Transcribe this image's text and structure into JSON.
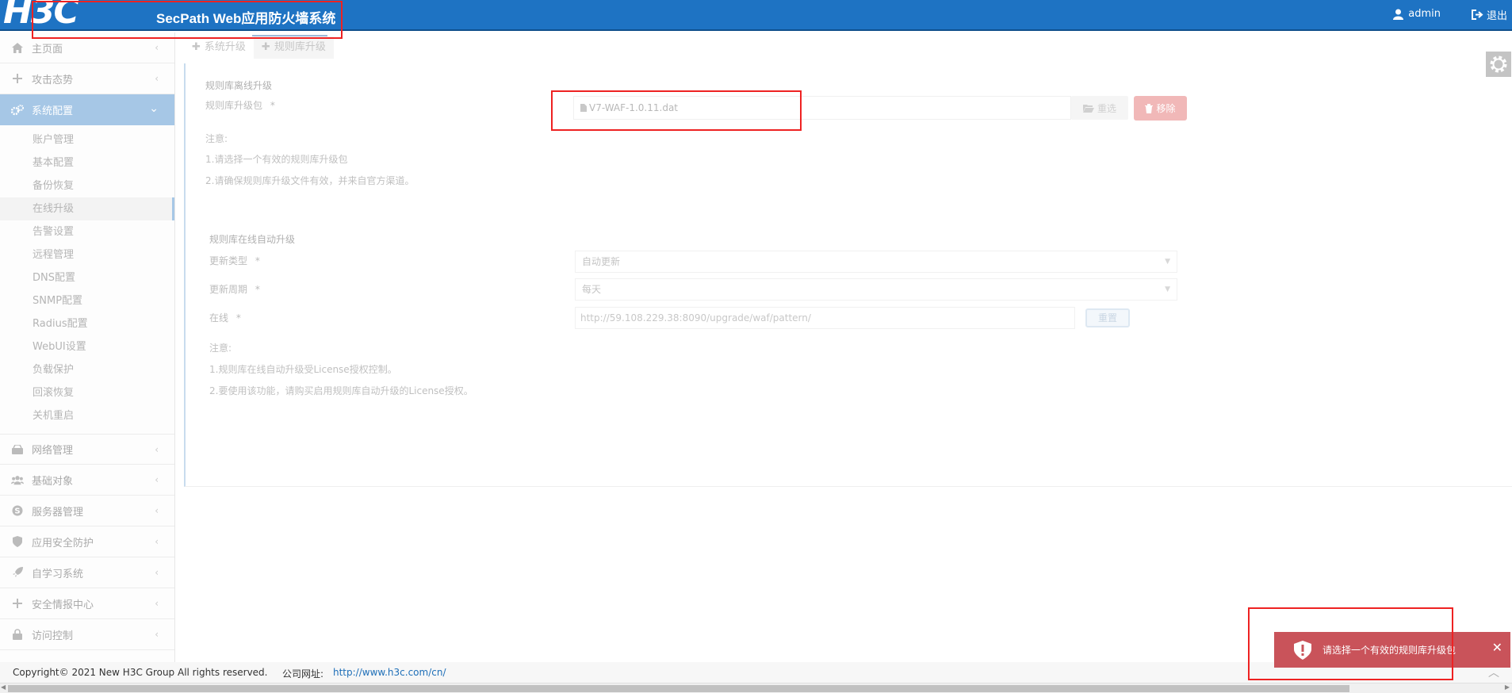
{
  "header": {
    "logo_text": "H3C",
    "app_title": "SecPath Web应用防火墙系统",
    "user": "admin",
    "logout": "退出",
    "bg_color": "#1e73c3"
  },
  "sidebar": {
    "items": [
      {
        "label": "主页面",
        "icon": "home-icon"
      },
      {
        "label": "攻击态势",
        "icon": "plus-icon"
      },
      {
        "label": "系统配置",
        "icon": "gears-icon",
        "active": true
      },
      {
        "label": "网络管理",
        "icon": "hdd-icon"
      },
      {
        "label": "基础对象",
        "icon": "users-icon"
      },
      {
        "label": "服务器管理",
        "icon": "skype-icon"
      },
      {
        "label": "应用安全防护",
        "icon": "shield-icon"
      },
      {
        "label": "自学习系统",
        "icon": "rocket-icon"
      },
      {
        "label": "安全情报中心",
        "icon": "plus-icon"
      },
      {
        "label": "访问控制",
        "icon": "lock-icon"
      }
    ],
    "sub_items": [
      "账户管理",
      "基本配置",
      "备份恢复",
      "在线升级",
      "告警设置",
      "远程管理",
      "DNS配置",
      "SNMP配置",
      "Radius配置",
      "WebUI设置",
      "负载保护",
      "回滚恢复",
      "关机重启"
    ],
    "current_sub": "在线升级"
  },
  "tabs": [
    {
      "label": "系统升级"
    },
    {
      "label": "规则库升级",
      "active": true
    }
  ],
  "offline": {
    "section_title": "规则库离线升级",
    "package_label": "规则库升级包",
    "required_mark": "*",
    "file_value": "V7-WAF-1.0.11.dat",
    "reselect_label": "重选",
    "remove_label": "移除",
    "notes_title": "注意:",
    "notes": [
      "1.请选择一个有效的规则库升级包",
      "2.请确保规则库升级文件有效，并来自官方渠道。"
    ]
  },
  "online": {
    "section_title": "规则库在线自动升级",
    "update_type_label": "更新类型",
    "update_type_value": "自动更新",
    "update_period_label": "更新周期",
    "update_period_value": "每天",
    "online_label": "在线",
    "online_url": "http://59.108.229.38:8090/upgrade/waf/pattern/",
    "reset_label": "重置",
    "notes_title": "注意:",
    "notes": [
      "1.规则库在线自动升级受License授权控制。",
      "2.要使用该功能，请购买启用规则库自动升级的License授权。"
    ]
  },
  "footer": {
    "copyright": "Copyright© 2021 New H3C Group All rights reserved.",
    "site_label": "公司网址:",
    "site_url": "http://www.h3c.com/cn/"
  },
  "toast": {
    "message": "请选择一个有效的规则库升级包",
    "color": "#c9535a"
  }
}
